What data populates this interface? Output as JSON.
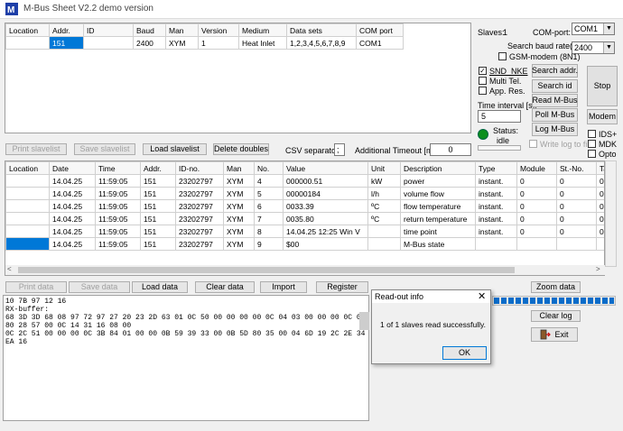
{
  "window": {
    "title": "M-Bus Sheet  V2.2 demo version"
  },
  "slaves_table": {
    "headers": [
      "Location",
      "Addr.",
      "ID",
      "Baud",
      "Man",
      "Version",
      "Medium",
      "Data sets",
      "COM port"
    ],
    "rows": [
      [
        "",
        "151",
        "",
        "2400",
        "XYM",
        "1",
        "Heat Inlet",
        "1,2,3,4,5,6,7,8,9",
        "COM1"
      ]
    ]
  },
  "right_panel": {
    "slaves_label": "Slaves:",
    "slaves_count": "1",
    "com_port_label": "COM-port:",
    "com_port_value": "COM1",
    "search_baud_label": "Search baud rate(s):",
    "search_baud_value": "2400",
    "gsm_label": "GSM-modem (8N1)",
    "snd_nke_label": "SND_NKE",
    "multi_tel_label": "Multi Tel.",
    "app_res_label": "App. Res.",
    "time_interval_label": "Time interval [s]:",
    "time_interval_value": "5",
    "status_label": "Status:",
    "status_value": "idle",
    "search_addr_label": "Search addr.",
    "search_id_label": "Search id",
    "read_mbus_label": "Read M-Bus",
    "poll_mbus_label": "Poll M-Bus",
    "log_mbus_label": "Log M-Bus",
    "write_log_label": "Write log to file",
    "stop_label": "Stop",
    "modem_label": "Modem",
    "ids_label": "IDS+",
    "mdk_label": "MDK",
    "opto_label": "Opto"
  },
  "slave_toolbar": {
    "print_slavelist": "Print slavelist",
    "save_slavelist": "Save slavelist",
    "load_slavelist": "Load slavelist",
    "delete_doubles": "Delete doubles",
    "csv_separator_label": "CSV separator:",
    "csv_separator_value": ";",
    "timeout_label": "Additional Timeout [ms]:",
    "timeout_value": "0"
  },
  "data_table": {
    "headers": [
      "Location",
      "Date",
      "Time",
      "Addr.",
      "ID-no.",
      "Man",
      "No.",
      "Value",
      "Unit",
      "Description",
      "Type",
      "Module",
      "St.-No.",
      "Ta"
    ],
    "rows": [
      [
        "",
        "14.04.25",
        "11:59:05",
        "151",
        "23202797",
        "XYM",
        "4",
        "000000.51",
        "kW",
        "power",
        "instant.",
        "0",
        "0",
        "0"
      ],
      [
        "",
        "14.04.25",
        "11:59:05",
        "151",
        "23202797",
        "XYM",
        "5",
        "00000184",
        "l/h",
        "volume flow",
        "instant.",
        "0",
        "0",
        "0"
      ],
      [
        "",
        "14.04.25",
        "11:59:05",
        "151",
        "23202797",
        "XYM",
        "6",
        "0033.39",
        "ºC",
        "flow temperature",
        "instant.",
        "0",
        "0",
        "0"
      ],
      [
        "",
        "14.04.25",
        "11:59:05",
        "151",
        "23202797",
        "XYM",
        "7",
        "0035.80",
        "ºC",
        "return temperature",
        "instant.",
        "0",
        "0",
        "0"
      ],
      [
        "",
        "14.04.25",
        "11:59:05",
        "151",
        "23202797",
        "XYM",
        "8",
        "14.04.25 12:25 Win  V",
        "",
        "time point",
        "instant.",
        "0",
        "0",
        "0"
      ],
      [
        "",
        "14.04.25",
        "11:59:05",
        "151",
        "23202797",
        "XYM",
        "9",
        "$00",
        "",
        "M-Bus state",
        "",
        "",
        "",
        ""
      ]
    ]
  },
  "data_toolbar": {
    "print_data": "Print data",
    "save_data": "Save data",
    "load_data": "Load data",
    "clear_data": "Clear data",
    "import": "Import",
    "register": "Register",
    "zoom_data": "Zoom data",
    "clear_log": "Clear log",
    "exit": "Exit"
  },
  "log": {
    "lines": [
      "10 7B 97 12 16",
      "RX-buffer:",
      "68 3D 3D 68 08 97 72 97 27 20 23 2D 63 01 0C 50 00 00 00 00 0C 04 03 00 00 00 0C 04 80 28 57 00 0C 14 31 16 08 00",
      "0C 2C 51 00 00 00 0C 3B 84 01 00 00 0B 59 39 33 00 0B 5D 80 35 00 04 6D 19 2C 2E 34 EA 16"
    ]
  },
  "dialog": {
    "title": "Read-out info",
    "message": "1 of 1 slaves read successfully.",
    "ok_label": "OK"
  },
  "progress": {
    "fraction": 1.0
  }
}
